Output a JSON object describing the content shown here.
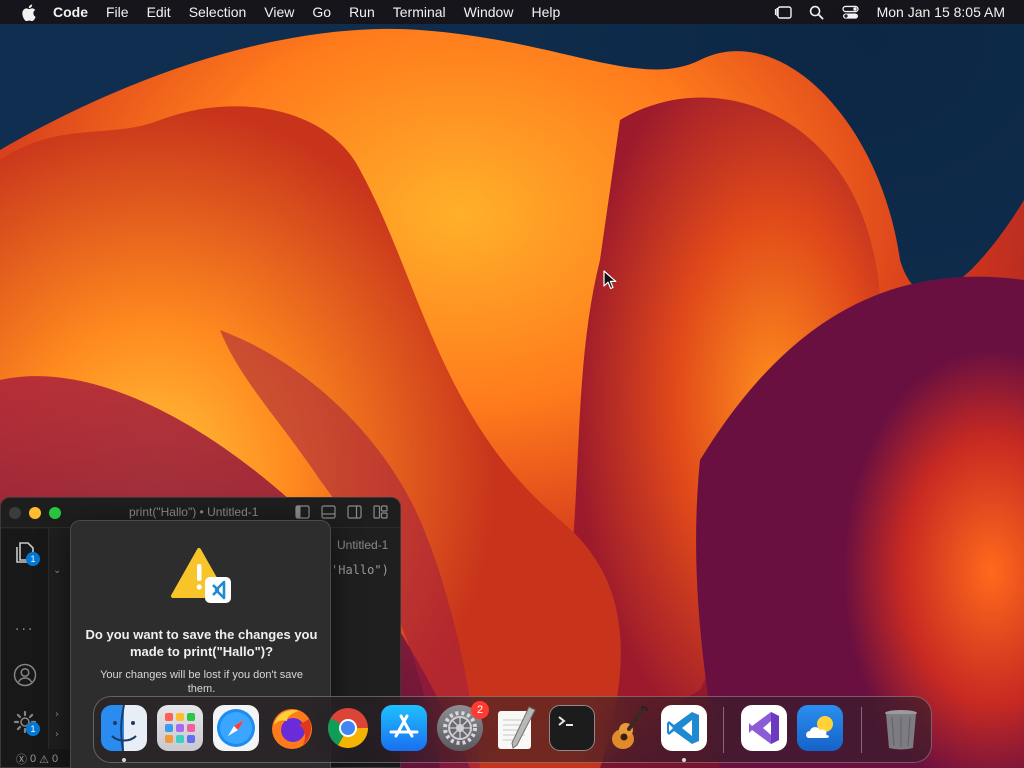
{
  "menubar": {
    "app_name": "Code",
    "menus": [
      "File",
      "Edit",
      "Selection",
      "View",
      "Go",
      "Run",
      "Terminal",
      "Window",
      "Help"
    ],
    "clock": "Mon Jan 15  8:05 AM",
    "status_icons": [
      "stage-manager-icon",
      "spotlight-search-icon",
      "control-center-icon"
    ]
  },
  "vscode": {
    "window_title": "print(\"Hallo\") • Untitled-1",
    "tab_label": "Untitled-1",
    "code_fragment": "'Hallo\")",
    "explorer_badge": "1",
    "settings_badge": "1",
    "status": {
      "errors": "0",
      "warnings": "0"
    },
    "accent": "#0078d4"
  },
  "dialog": {
    "title": "Do you want to save the changes you made to print(\"Hallo\")?",
    "message": "Your changes will be lost if you don't save them."
  },
  "dock": {
    "items": [
      {
        "name": "Finder",
        "icon": "finder-icon",
        "running": true
      },
      {
        "name": "Launchpad",
        "icon": "launchpad-icon",
        "running": false
      },
      {
        "name": "Safari",
        "icon": "safari-icon",
        "running": false
      },
      {
        "name": "Firefox",
        "icon": "firefox-icon",
        "running": false
      },
      {
        "name": "Google Chrome",
        "icon": "chrome-icon",
        "running": false
      },
      {
        "name": "App Store",
        "icon": "app-store-icon",
        "running": false
      },
      {
        "name": "System Settings",
        "icon": "system-settings-icon",
        "running": false,
        "badge": "2"
      },
      {
        "name": "TextEdit",
        "icon": "textedit-icon",
        "running": false
      },
      {
        "name": "Terminal",
        "icon": "terminal-icon",
        "running": false
      },
      {
        "name": "GarageBand",
        "icon": "garageband-icon",
        "running": false
      },
      {
        "name": "Visual Studio Code",
        "icon": "vscode-icon",
        "running": true
      },
      {
        "name": "Visual Studio",
        "icon": "visual-studio-icon",
        "running": false
      },
      {
        "name": "Weather",
        "icon": "weather-icon",
        "running": false
      },
      {
        "name": "Trash",
        "icon": "trash-icon",
        "running": false
      }
    ]
  }
}
